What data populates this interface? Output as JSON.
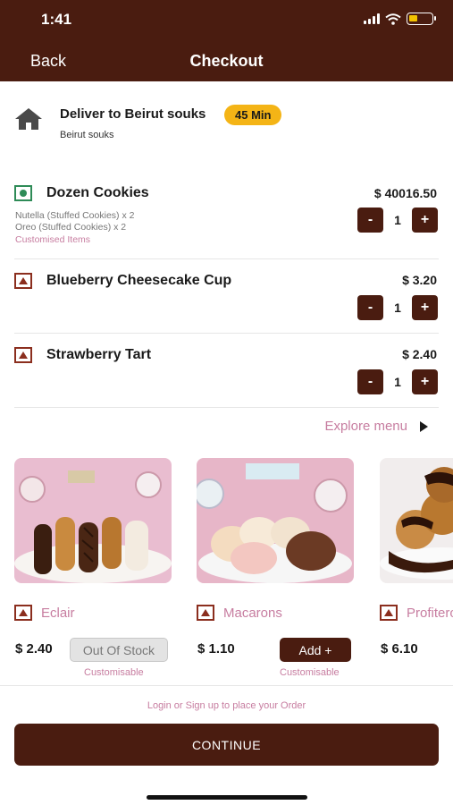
{
  "status_bar": {
    "time": "1:41"
  },
  "nav": {
    "back_label": "Back",
    "title": "Checkout"
  },
  "delivery": {
    "title": "Deliver to Beirut souks",
    "eta": "45 Min",
    "subtitle": "Beirut souks"
  },
  "cart": [
    {
      "name": "Dozen Cookies",
      "price": "$ 40016.50",
      "qty": "1",
      "type": "veg",
      "details": [
        "Nutella (Stuffed Cookies) x 2",
        "Oreo (Stuffed Cookies) x 2"
      ],
      "custom_label": "Customised Items"
    },
    {
      "name": "Blueberry Cheesecake Cup",
      "price": "$ 3.20",
      "qty": "1",
      "type": "egg"
    },
    {
      "name": "Strawberry Tart",
      "price": "$ 2.40",
      "qty": "1",
      "type": "egg"
    }
  ],
  "stepper": {
    "minus": "-",
    "plus": "+"
  },
  "explore": {
    "label": "Explore menu"
  },
  "products": [
    {
      "name": "Eclair",
      "price": "$ 2.40",
      "button": "Out Of Stock",
      "sub": "Customisable"
    },
    {
      "name": "Macarons",
      "price": "$ 1.10",
      "button": "Add +",
      "sub": "Customisable"
    },
    {
      "name": "Profiteroles",
      "price": "$ 6.10"
    }
  ],
  "footer": {
    "login_hint": "Login or Sign up to place your Order",
    "continue": "CONTINUE"
  },
  "colors": {
    "brand": "#4a1c10",
    "accent_pink": "#c77da0",
    "eta_yellow": "#f4b416"
  }
}
